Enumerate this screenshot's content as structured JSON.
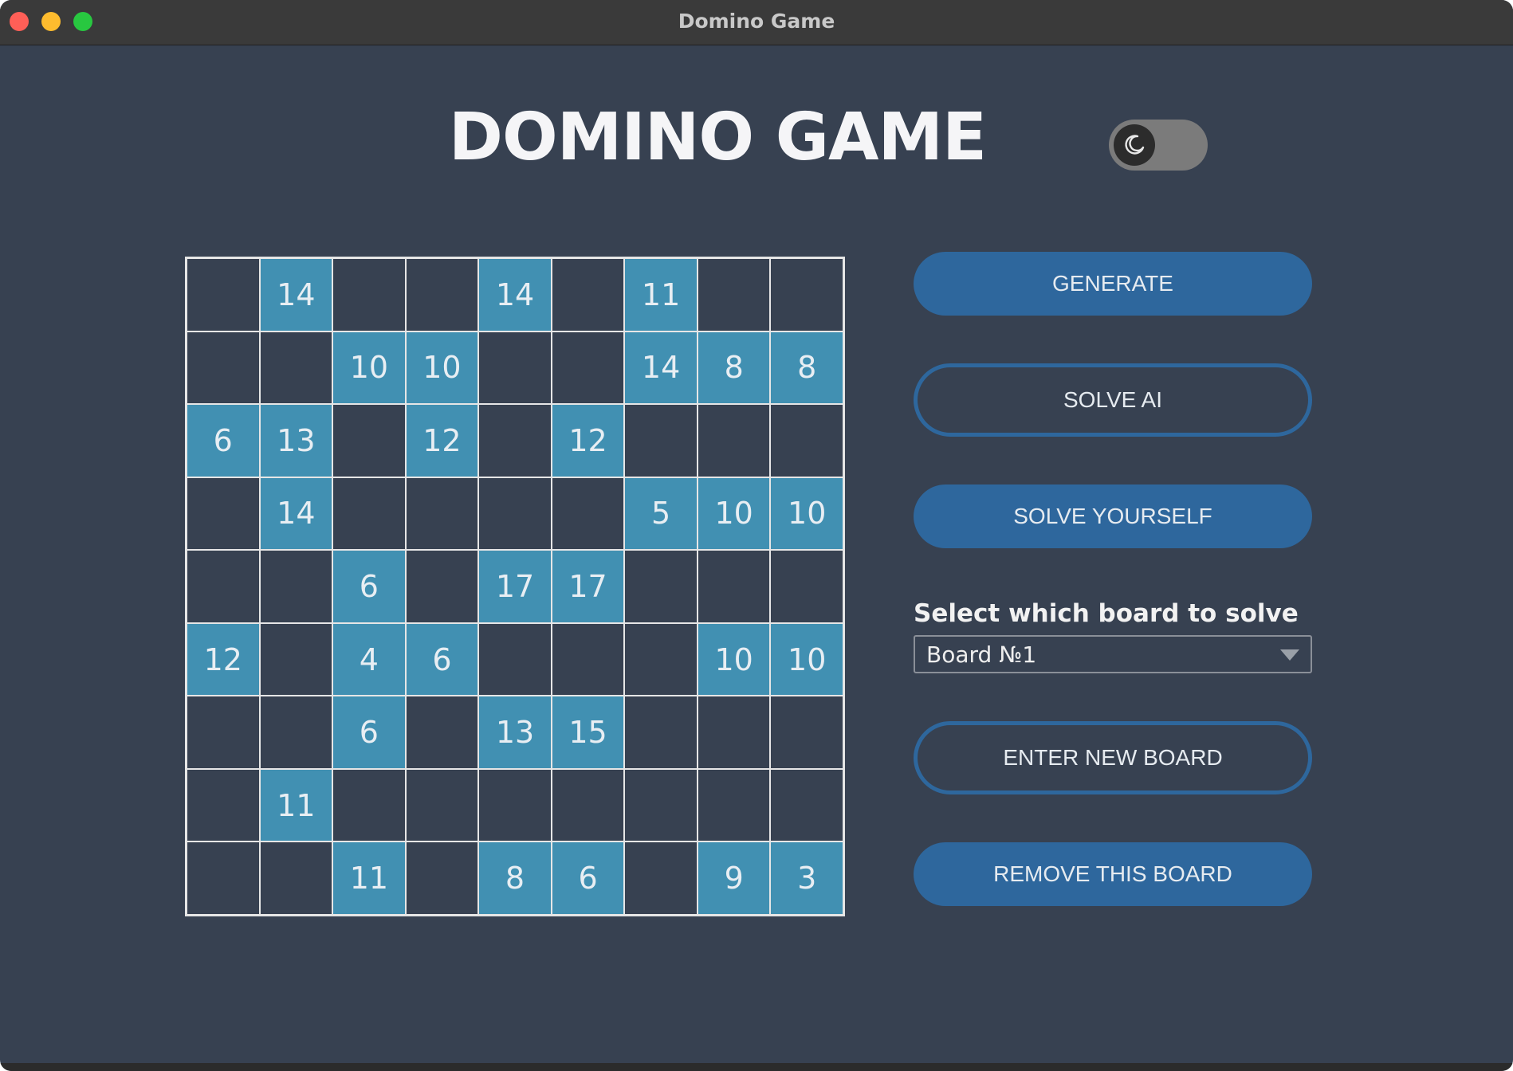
{
  "window": {
    "title": "Domino Game"
  },
  "header": {
    "title": "DOMINO GAME",
    "theme_toggle_icon": "moon-icon"
  },
  "board": {
    "rows": [
      [
        "",
        "14",
        "",
        "",
        "14",
        "",
        "11",
        "",
        ""
      ],
      [
        "",
        "",
        "10",
        "10",
        "",
        "",
        "14",
        "8",
        "8"
      ],
      [
        "6",
        "13",
        "",
        "12",
        "",
        "12",
        "",
        "",
        ""
      ],
      [
        "",
        "14",
        "",
        "",
        "",
        "",
        "5",
        "10",
        "10"
      ],
      [
        "",
        "",
        "6",
        "",
        "17",
        "17",
        "",
        "",
        ""
      ],
      [
        "12",
        "",
        "4",
        "6",
        "",
        "",
        "",
        "10",
        "10"
      ],
      [
        "",
        "",
        "6",
        "",
        "13",
        "15",
        "",
        "",
        ""
      ],
      [
        "",
        "11",
        "",
        "",
        "",
        "",
        "",
        "",
        ""
      ],
      [
        "",
        "",
        "11",
        "",
        "8",
        "6",
        "",
        "9",
        "3"
      ]
    ]
  },
  "controls": {
    "generate_label": "GENERATE",
    "solve_ai_label": "SOLVE AI",
    "solve_yourself_label": "SOLVE YOURSELF",
    "select_label": "Select which board to solve",
    "board_select_value": "Board №1",
    "enter_new_board_label": "ENTER NEW BOARD",
    "remove_board_label": "REMOVE THIS BOARD"
  },
  "colors": {
    "background": "#374151",
    "filled_cell": "#4190b2",
    "button": "#2e679d"
  }
}
